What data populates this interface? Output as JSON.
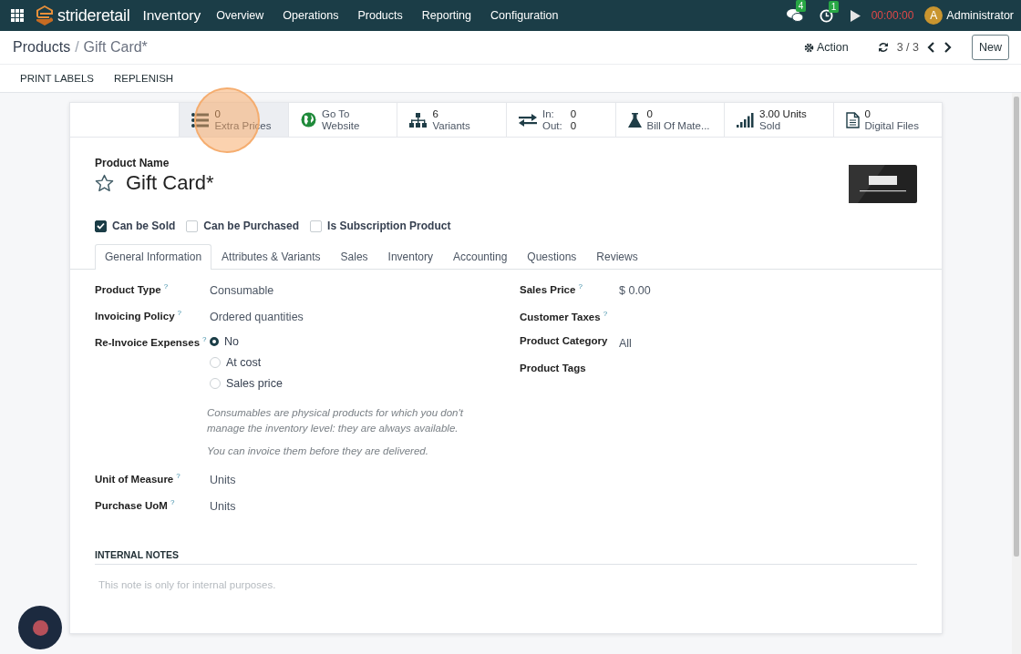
{
  "navbar": {
    "brand": "**stride**retail",
    "app": "Inventory",
    "menu": [
      "Overview",
      "Operations",
      "Products",
      "Reporting",
      "Configuration"
    ],
    "messages_badge": "4",
    "activities_badge": "1",
    "timer": "00:00:00",
    "user_initial": "A",
    "user_name": "Administrator"
  },
  "breadcrumb": {
    "parent": "Products",
    "separator": "/",
    "current": "Gift Card*"
  },
  "control_panel": {
    "action": "Action",
    "pager": "3 / 3",
    "new_button": "New"
  },
  "header_buttons": [
    "PRINT LABELS",
    "REPLENISH"
  ],
  "smart_buttons": [
    {
      "kind": "stat",
      "value": "0",
      "label": "Extra Prices",
      "hovered": true
    },
    {
      "kind": "link",
      "label": "Go To Website",
      "hovered": false
    },
    {
      "kind": "stat",
      "value": "6",
      "label": "Variants",
      "hovered": false
    },
    {
      "kind": "inout",
      "rows": [
        {
          "label": "In:",
          "value": "0"
        },
        {
          "label": "Out:",
          "value": "0"
        }
      ],
      "hovered": false
    },
    {
      "kind": "stat",
      "value": "0",
      "label": "Bill Of Mate...",
      "hovered": false
    },
    {
      "kind": "stat",
      "value": "3.00 Units",
      "label": "Sold",
      "hovered": false
    },
    {
      "kind": "stat",
      "value": "0",
      "label": "Digital Files",
      "hovered": false
    }
  ],
  "product": {
    "name_label": "Product Name",
    "name": "Gift Card*",
    "favorite": false
  },
  "options": [
    {
      "label": "Can be Sold",
      "checked": true
    },
    {
      "label": "Can be Purchased",
      "checked": false
    },
    {
      "label": "Is Subscription Product",
      "checked": false
    }
  ],
  "tabs": [
    {
      "label": "General Information",
      "selected": true
    },
    {
      "label": "Attributes & Variants",
      "selected": false
    },
    {
      "label": "Sales",
      "selected": false
    },
    {
      "label": "Inventory",
      "selected": false
    },
    {
      "label": "Accounting",
      "selected": false
    },
    {
      "label": "Questions",
      "selected": false
    },
    {
      "label": "Reviews",
      "selected": false
    }
  ],
  "left_fields": [
    {
      "kind": "text",
      "label": "Product Type",
      "help": "?",
      "value": "Consumable"
    },
    {
      "kind": "text",
      "label": "Invoicing Policy",
      "help": "?",
      "value": "Ordered quantities"
    },
    {
      "kind": "radio",
      "label": "Re-Invoice Expenses",
      "help": "?",
      "options": [
        {
          "label": "No",
          "selected": true
        },
        {
          "label": "At cost",
          "selected": false
        },
        {
          "label": "Sales price",
          "selected": false
        }
      ]
    },
    {
      "kind": "hint",
      "lines": [
        "Consumables are physical products for which you don't manage the inventory level: they are always available.",
        "You can invoice them before they are delivered."
      ]
    },
    {
      "kind": "text",
      "label": "Unit of Measure",
      "help": "?",
      "value": "Units"
    },
    {
      "kind": "text",
      "label": "Purchase UoM",
      "help": "?",
      "value": "Units"
    }
  ],
  "right_fields": [
    {
      "label": "Sales Price",
      "help": "?",
      "value": "$ 0.00"
    },
    {
      "label": "Customer Taxes",
      "help": "?"
    },
    {
      "label": "Product Category",
      "value": "All"
    },
    {
      "label": "Product Tags"
    }
  ],
  "internal_notes": {
    "heading": "INTERNAL NOTES",
    "placeholder": "This note is only for internal purposes."
  }
}
